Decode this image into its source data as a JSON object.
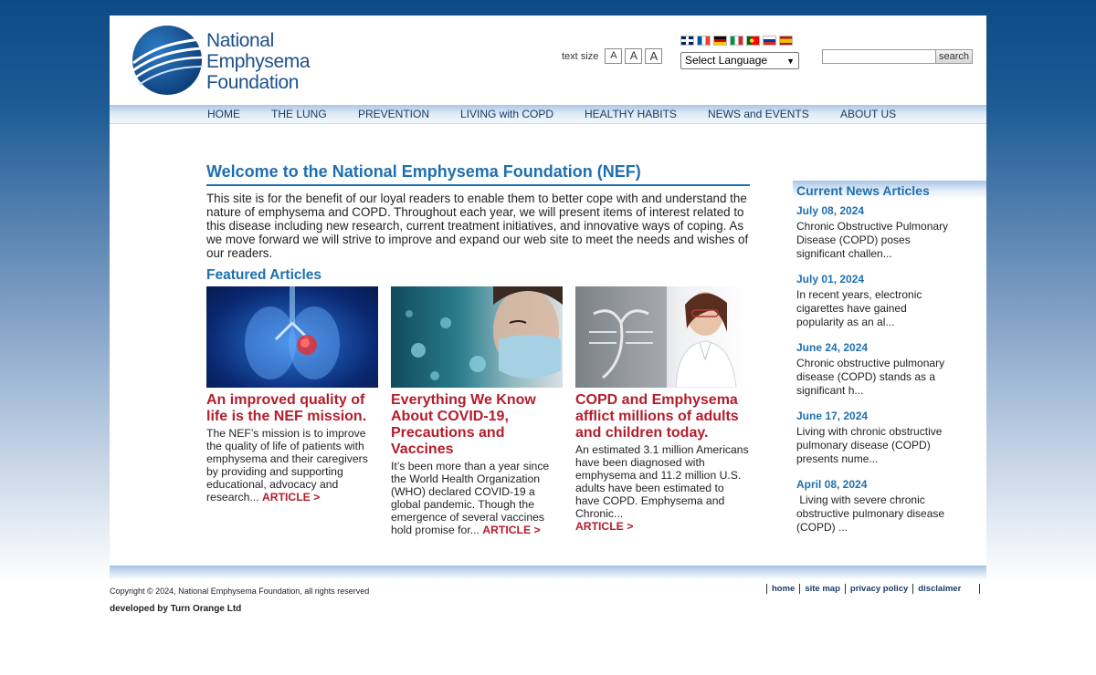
{
  "logo": {
    "line1": "National",
    "line2": "Emphysema",
    "line3": "Foundation"
  },
  "header": {
    "text_size_label": "text size",
    "text_size_buttons": [
      "A",
      "A",
      "A"
    ],
    "language_select": "Select Language",
    "search_label": "search",
    "flags": [
      "english-flag",
      "french-flag",
      "german-flag",
      "italian-flag",
      "portuguese-flag",
      "russian-flag",
      "spanish-flag"
    ]
  },
  "nav": [
    "HOME",
    "THE LUNG",
    "PREVENTION",
    "LIVING with COPD",
    "HEALTHY HABITS",
    "NEWS and EVENTS",
    "ABOUT US"
  ],
  "main": {
    "title": "Welcome to the National Emphysema Foundation (NEF)",
    "intro": "This site is for the benefit of our loyal readers to enable them to better cope with and understand the nature of emphysema and COPD. Throughout each year, we will present items of interest related to this disease including new research, current treatment initiatives, and innovative ways of coping.  As we move forward we will strive to improve and expand our web site to meet the needs and wishes of our readers.",
    "featured_heading": "Featured Articles",
    "articles": [
      {
        "title": "An improved quality of life is the NEF mission.",
        "body": "The NEF’s mission is to improve the quality of life of patients with emphysema and their caregivers by providing and supporting educational, advocacy and research... ",
        "link": "ARTICLE >",
        "image": "lungs-illustration"
      },
      {
        "title": "Everything We Know About COVID-19, Precautions and Vaccines",
        "body": "It’s been more than a year since the World Health Organization (WHO) declared COVID-19 a global pandemic. Though the emergence of several vaccines hold promise for... ",
        "link": "ARTICLE >",
        "image": "woman-mask-virus"
      },
      {
        "title": "COPD and Emphysema afflict millions of adults and children today.",
        "body": "An estimated 3.1 million Americans have been diagnosed with emphysema and 11.2 million U.S. adults have been estimated to have COPD. Emphysema and Chronic...",
        "link": "ARTICLE >",
        "image": "doctor-xray"
      }
    ]
  },
  "sidebar": {
    "heading": "Current News Articles",
    "items": [
      {
        "date": "July 08, 2024",
        "text": "Chronic Obstructive Pulmonary Disease (COPD) poses significant challen..."
      },
      {
        "date": "July 01, 2024",
        "text": "In recent years, electronic cigarettes have gained popularity as an al..."
      },
      {
        "date": "June 24, 2024",
        "text": "Chronic obstructive pulmonary disease (COPD) stands as a significant h..."
      },
      {
        "date": "June 17, 2024",
        "text": "Living with chronic obstructive pulmonary disease (COPD) presents nume..."
      },
      {
        "date": "April 08, 2024",
        "text": " Living with severe chronic obstructive pulmonary disease (COPD) ..."
      }
    ]
  },
  "footer": {
    "copyright": "Copyright © 2024, National Emphysema Foundation, all rights reserved",
    "developed": "developed by Turn Orange Ltd",
    "links": [
      "home",
      "site map",
      "privacy policy",
      "disclaimer"
    ]
  },
  "colors": {
    "brand_blue": "#1f6fb0",
    "headline_red": "#b31d2c",
    "nav_text": "#1a3d68"
  }
}
